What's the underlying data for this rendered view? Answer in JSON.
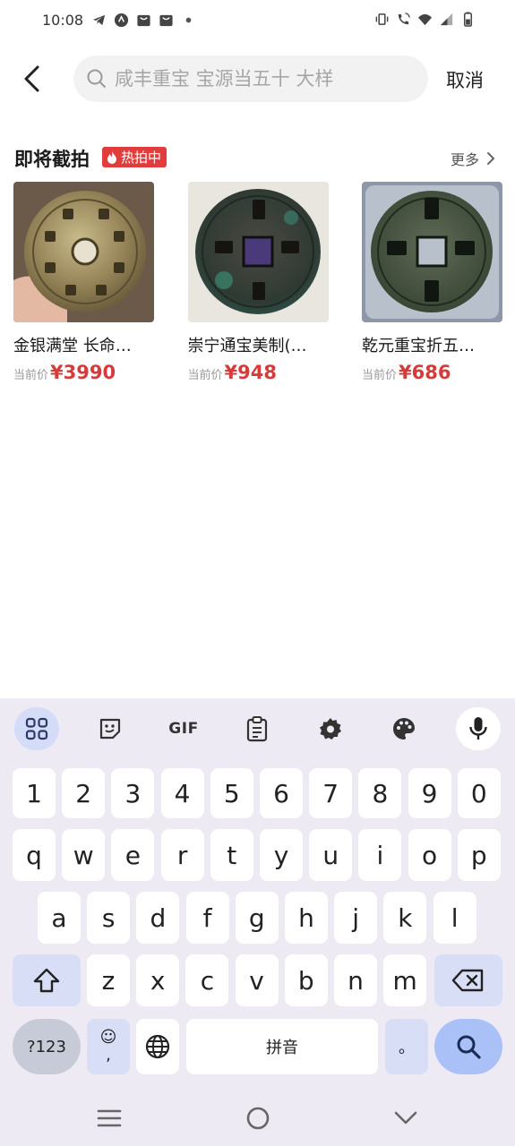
{
  "status_bar": {
    "time": "10:08"
  },
  "search": {
    "placeholder": "咸丰重宝 宝源当五十 大样",
    "value": ""
  },
  "header": {
    "cancel_label": "取消"
  },
  "auction": {
    "title": "即将截拍",
    "badge": "热拍中",
    "more_label": "更多",
    "items": [
      {
        "name": "金银满堂 长命…",
        "price_label": "当前价",
        "price": "¥3990"
      },
      {
        "name": "崇宁通宝美制(…",
        "price_label": "当前价",
        "price": "¥948"
      },
      {
        "name": "乾元重宝折五…",
        "price_label": "当前价",
        "price": "¥686"
      }
    ]
  },
  "keyboard": {
    "gif_label": "GIF",
    "row_numbers": [
      "1",
      "2",
      "3",
      "4",
      "5",
      "6",
      "7",
      "8",
      "9",
      "0"
    ],
    "row_1": [
      "q",
      "w",
      "e",
      "r",
      "t",
      "y",
      "u",
      "i",
      "o",
      "p"
    ],
    "row_2": [
      "a",
      "s",
      "d",
      "f",
      "g",
      "h",
      "j",
      "k",
      "l"
    ],
    "row_3": [
      "z",
      "x",
      "c",
      "v",
      "b",
      "n",
      "m"
    ],
    "symbols_label": "?123",
    "emoji_comma": "☺\n,",
    "space_label": "拼音",
    "period_label": "。"
  },
  "colors": {
    "price": "#d63b3b",
    "badge": "#e23c3c",
    "keyboard_bg": "#eeeaf3",
    "search_key": "#a9c1f7"
  }
}
